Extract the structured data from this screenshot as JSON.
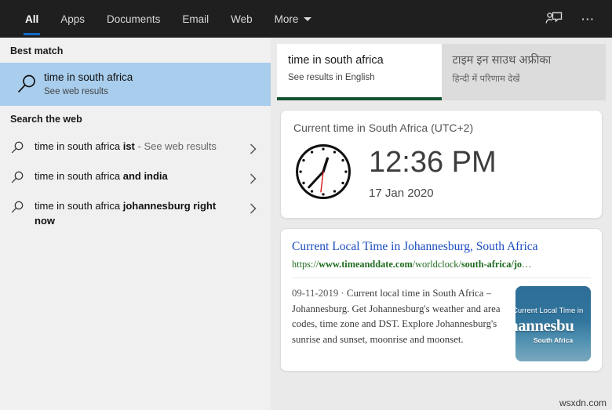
{
  "header": {
    "tabs": [
      {
        "label": "All",
        "active": true
      },
      {
        "label": "Apps",
        "active": false
      },
      {
        "label": "Documents",
        "active": false
      },
      {
        "label": "Email",
        "active": false
      },
      {
        "label": "Web",
        "active": false
      },
      {
        "label": "More",
        "active": false,
        "has_caret": true
      }
    ],
    "feedback_icon": "feedback-person-icon",
    "more_icon": "ellipsis-icon",
    "background_color": "#1f1f1f",
    "accent_color": "#1569c7"
  },
  "left_pane": {
    "best_match": {
      "section_label": "Best match",
      "icon": "search-icon",
      "title": "time in south africa",
      "subtitle": "See web results",
      "highlight_color": "#a8cded"
    },
    "search_the_web": {
      "section_label": "Search the web",
      "items": [
        {
          "icon": "search-icon",
          "prefix": "time in south africa ",
          "bold": "ist",
          "suffix": " - See web results",
          "chevron": "chevron-right-icon"
        },
        {
          "icon": "search-icon",
          "prefix": "time in south africa ",
          "bold": "and india",
          "suffix": "",
          "chevron": "chevron-right-icon"
        },
        {
          "icon": "search-icon",
          "prefix": "time in south africa ",
          "bold": "johannesburg right now",
          "suffix": "",
          "chevron": "chevron-right-icon"
        }
      ]
    }
  },
  "right_pane": {
    "language_tabs": [
      {
        "title": "time in south africa",
        "subtitle": "See results in English",
        "active": true,
        "underline_color": "#14512f"
      },
      {
        "title": "टाइम इन साउथ अफ्रीका",
        "subtitle": "हिन्दी में परिणाम देखें",
        "active": false
      }
    ],
    "time_card": {
      "heading": "Current time in South Africa (UTC+2)",
      "time": "12:36 PM",
      "date": "17 Jan 2020",
      "clock_icon": "analog-clock-icon",
      "clock_hour_deg": 18,
      "clock_minute_deg": 216,
      "clock_second_deg": 186
    },
    "result_card": {
      "title": "Current Local Time in Johannesburg, South Africa",
      "url_parts": [
        {
          "text": "https://",
          "bold": false
        },
        {
          "text": "www.timeanddate.com",
          "bold": true
        },
        {
          "text": "/worldclock/",
          "bold": false
        },
        {
          "text": "south-africa/jo",
          "bold": true
        },
        {
          "text": "…",
          "bold": false
        }
      ],
      "date_prefix": "09-11-2019 · ",
      "description": "Current local time in South Africa – Johannesburg. Get Johannesburg's weather and area codes, time zone and DST. Explore Johannesburg's sunrise and sunset, moonrise and moonset.",
      "thumbnail": {
        "line1": "Current Local Time in",
        "line2": "hannesbu",
        "line3": "South Africa"
      }
    }
  },
  "watermark": "wsxdn.com"
}
